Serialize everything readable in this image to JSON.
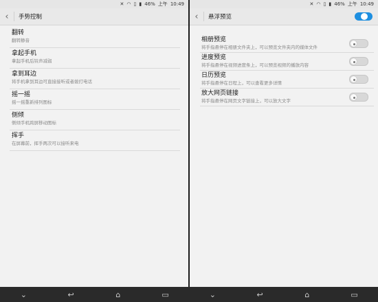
{
  "status": {
    "time": "10:49",
    "period": "上午",
    "battery": "46%"
  },
  "left": {
    "title": "手势控制",
    "items": [
      {
        "title": "翻转",
        "subtitle": "翻转静音"
      },
      {
        "title": "拿起手机",
        "subtitle": "拿起手机后铃声减弱"
      },
      {
        "title": "拿到耳边",
        "subtitle": "将手机拿到耳边可直接接听或者拨打电话"
      },
      {
        "title": "摇一摇",
        "subtitle": "摇一摇重新排列图标"
      },
      {
        "title": "侧倾",
        "subtitle": "侧倾手机跨屏移动图标"
      },
      {
        "title": "挥手",
        "subtitle": "在屏幕前，挥手两次可以接听来电"
      }
    ]
  },
  "right": {
    "title": "悬浮预览",
    "master_toggle": "on",
    "items": [
      {
        "title": "相册预览",
        "subtitle": "将手指悬停在相册文件夹上，可以预览文件夹内的媒体文件",
        "state": "off"
      },
      {
        "title": "进度预览",
        "subtitle": "将手指悬停在视频进度条上，可以预览视频的播放内容",
        "state": "off"
      },
      {
        "title": "日历预览",
        "subtitle": "将手指悬停在日程上，可以查看更多详情",
        "state": "off"
      },
      {
        "title": "放大网页链接",
        "subtitle": "将手指悬停在网页文字链接上，可以放大文字",
        "state": "off"
      }
    ]
  },
  "icons": {
    "back": "back-arrow-icon",
    "nav": [
      "chevron-down-icon",
      "back-icon",
      "home-icon",
      "recents-icon"
    ]
  }
}
